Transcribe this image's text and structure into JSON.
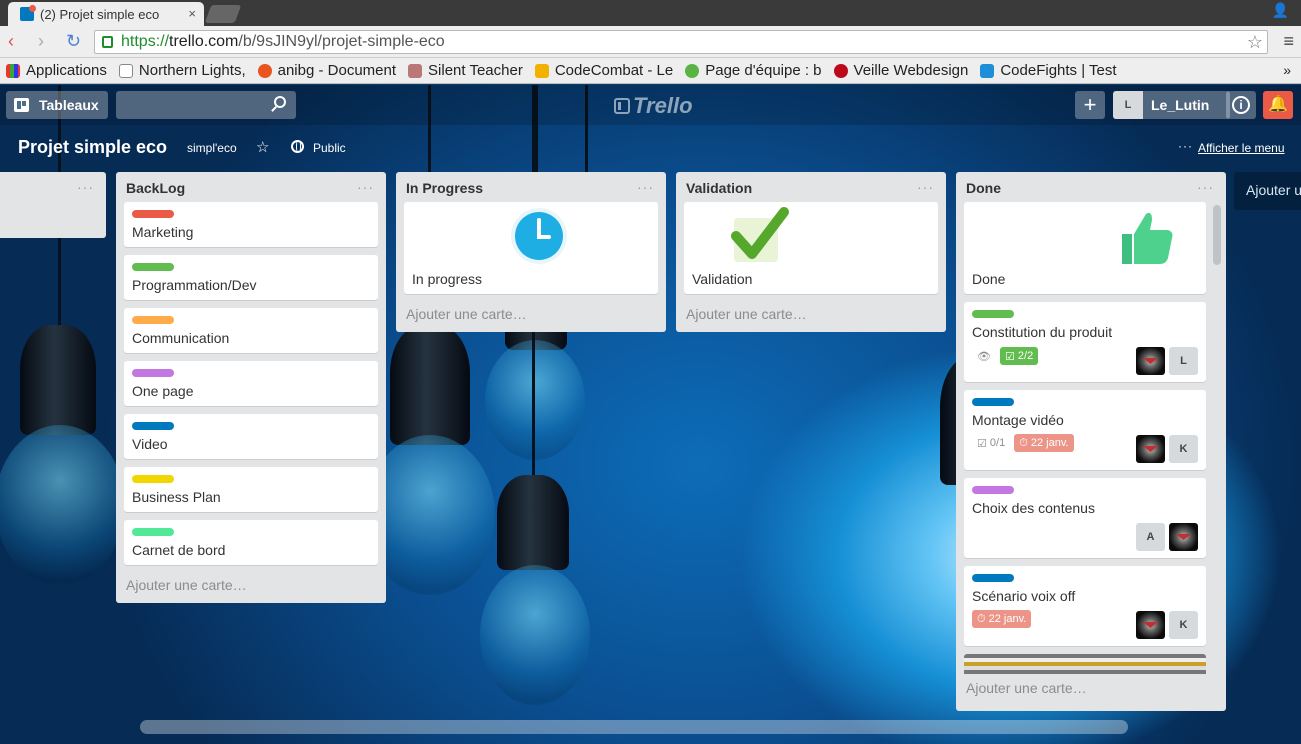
{
  "browser": {
    "tab_title": "(2) Projet simple eco",
    "tab_close": "×",
    "url_scheme": "https://",
    "url_host": "trello.com",
    "url_path": "/b/9sJIN9yl/projet-simple-eco",
    "bookmarks": [
      {
        "label": "Applications",
        "color": "#e33"
      },
      {
        "label": "Northern Lights,",
        "color": "#ddd"
      },
      {
        "label": "anibg - Document",
        "color": "#e95420"
      },
      {
        "label": "Silent Teacher",
        "color": "#b77"
      },
      {
        "label": "CodeCombat - Le",
        "color": "#f2b000"
      },
      {
        "label": "Page d'équipe : b",
        "color": "#5ab443"
      },
      {
        "label": "Veille Webdesign",
        "color": "#bd081c"
      },
      {
        "label": "CodeFights | Test",
        "color": "#1c8fd8"
      }
    ],
    "bookmarks_more": "»"
  },
  "header": {
    "boards_button": "Tableaux",
    "search_placeholder": "",
    "logo_text": "Trello",
    "add_button": "+",
    "user_initial": "L",
    "username": "Le_Lutin",
    "info_icon": "i",
    "notifications_icon": "🔔"
  },
  "board": {
    "title": "Projet simple eco",
    "team": "simpl'eco",
    "star": "☆",
    "visibility": "Public",
    "menu_dots": "···",
    "menu_link": "Afficher le menu",
    "add_list": "Ajouter une liste"
  },
  "lists": {
    "backlog": {
      "title": "BackLog",
      "add_card": "Ajouter une carte…",
      "cards": [
        {
          "label_color": "#eb5a46",
          "title": "Marketing"
        },
        {
          "label_color": "#61bd4f",
          "title": "Programmation/Dev"
        },
        {
          "label_color": "#ffab4a",
          "title": "Communication"
        },
        {
          "label_color": "#c377e0",
          "title": "One page"
        },
        {
          "label_color": "#0079bf",
          "title": "Video"
        },
        {
          "label_color": "#f2d600",
          "title": "Business Plan"
        },
        {
          "label_color": "#51e898",
          "title": "Carnet de bord"
        }
      ]
    },
    "in_progress": {
      "title": "In Progress",
      "add_card": "Ajouter une carte…",
      "card_title": "In progress"
    },
    "validation": {
      "title": "Validation",
      "add_card": "Ajouter une carte…",
      "card_title": "Validation"
    },
    "done": {
      "title": "Done",
      "add_card": "Ajouter une carte…",
      "cards": [
        {
          "title": "Done"
        },
        {
          "title": "Constitution du produit",
          "label_color": "#61bd4f",
          "checklist": "2/2",
          "members": [
            "img",
            "L"
          ]
        },
        {
          "title": "Montage vidéo",
          "label_color": "#0079bf",
          "checklist": "0/1",
          "due": "22 janv.",
          "members": [
            "img",
            "K"
          ]
        },
        {
          "title": "Choix des contenus",
          "label_color": "#c377e0",
          "members": [
            "A",
            "img"
          ]
        },
        {
          "title": "Scénario voix off",
          "label_color": "#0079bf",
          "due": "22 janv.",
          "members": [
            "img",
            "K"
          ]
        }
      ]
    }
  },
  "list_menu_dots": "···"
}
